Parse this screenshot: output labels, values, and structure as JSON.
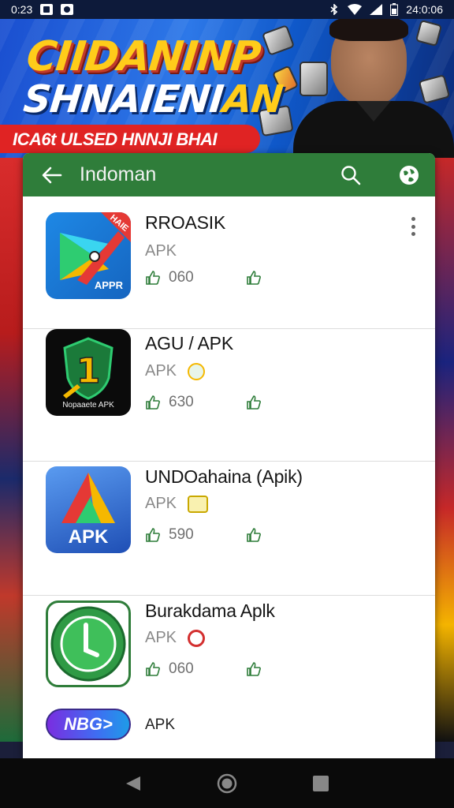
{
  "status_bar": {
    "time_left": "0:23",
    "time_right": "24:0:06"
  },
  "banner": {
    "title_line1": "CIIDANINP",
    "title_line2_a": "SHNAIENI",
    "title_line2_b": "AN",
    "ribbon_text": "ICA6t ULSED HNNJI BHAI"
  },
  "app_bar": {
    "title": "Indoman",
    "color": "#2f7d3a"
  },
  "apps": [
    {
      "name": "RROASIK",
      "subtitle": "APK",
      "likes": "060",
      "icon_label": "APPR",
      "corner_label": "HAIE"
    },
    {
      "name": "AGU / APK",
      "subtitle": "APK",
      "likes": "630",
      "icon_label": "Nopaaete APK",
      "icon_digit": "1"
    },
    {
      "name": "UNDOahaina (Apik)",
      "subtitle": "APK",
      "likes": "590",
      "icon_label": "APK"
    },
    {
      "name": "Burakdama Aplk",
      "subtitle": "APK",
      "likes": "060"
    }
  ],
  "last_item": {
    "icon_label": "NBG>",
    "label": "APK"
  },
  "icons": {
    "back": "arrow-left-icon",
    "search": "search-icon",
    "menu": "more-vert-icon",
    "globe": "globe-icon",
    "thumb": "thumb-up-icon",
    "nav_back": "nav-back-icon",
    "nav_home": "nav-home-icon",
    "nav_recent": "nav-recent-icon"
  }
}
